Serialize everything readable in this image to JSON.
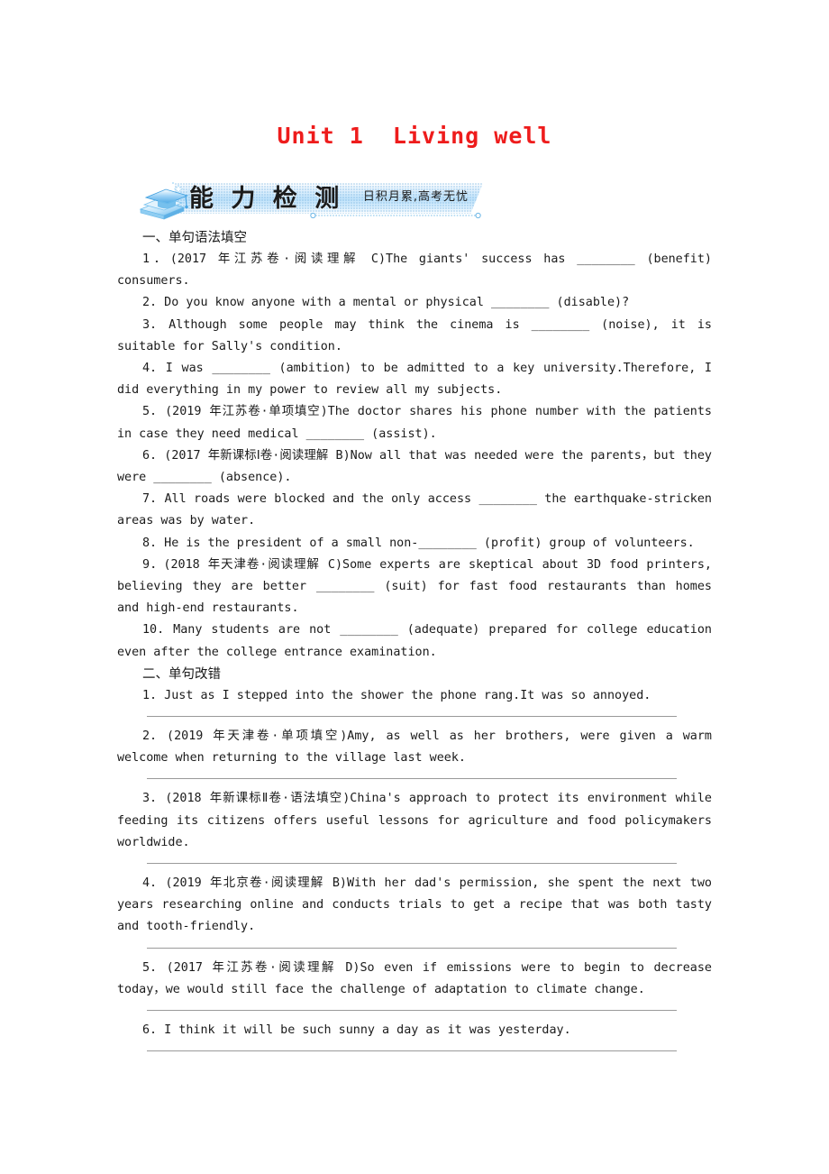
{
  "title": "Unit 1  Living well",
  "banner": {
    "heading": "能 力 检 测",
    "slogan": "日积月累,高考无忧",
    "icon": "graduation-cap-books-icon",
    "accent_color": "#bfe2fa",
    "title_color": "#ee1c1c"
  },
  "sections": [
    {
      "heading": "一、单句语法填空",
      "items": [
        "1．(2017 年江苏卷·阅读理解 C)The giants' success has ________ (benefit) consumers.",
        "2. Do you know anyone with a mental or physical ________ (disable)?",
        "3. Although some people may think the cinema is ________ (noise), it is suitable for Sally's condition.",
        "4. I was ________ (ambition) to be admitted to a key university.Therefore, I did everything in my power to review all my subjects.",
        "5. (2019 年江苏卷·单项填空)The doctor shares his phone number with the patients in case they need medical ________ (assist).",
        "6. (2017 年新课标Ⅰ卷·阅读理解 B)Now all that was needed were the parents，but they were ________ (absence).",
        "7. All roads were blocked and the only access ________ the earthquake-stricken areas was by water.",
        "8. He is the president of a small non-________ (profit) group of volunteers.",
        "9．(2018 年天津卷·阅读理解 C)Some experts are skeptical about 3D food printers, believing they are better ________ (suit) for fast food restaurants than homes and high-end restaurants.",
        "10. Many students are not ________ (adequate) prepared for college education even after the college entrance examination."
      ]
    },
    {
      "heading": "二、单句改错",
      "items": [
        "1. Just as I stepped into the shower the phone rang.It was so annoyed.",
        "2. (2019 年天津卷·单项填空)Amy, as well as her brothers, were given a warm welcome when returning to the village last week.",
        "3. (2018 年新课标Ⅱ卷·语法填空)China's approach to protect its environment while feeding its citizens offers useful lessons for agriculture and food policymakers worldwide.",
        "4. (2019 年北京卷·阅读理解 B)With her dad's permission, she spent the next two years researching online and conducts trials to get a recipe that was both tasty and tooth-friendly.",
        "5. (2017 年江苏卷·阅读理解 D)So even if emissions were to begin to decrease today，we would still face the challenge of adaptation to climate change.",
        "6. I think it will be such sunny a day as it was yesterday."
      ]
    }
  ]
}
